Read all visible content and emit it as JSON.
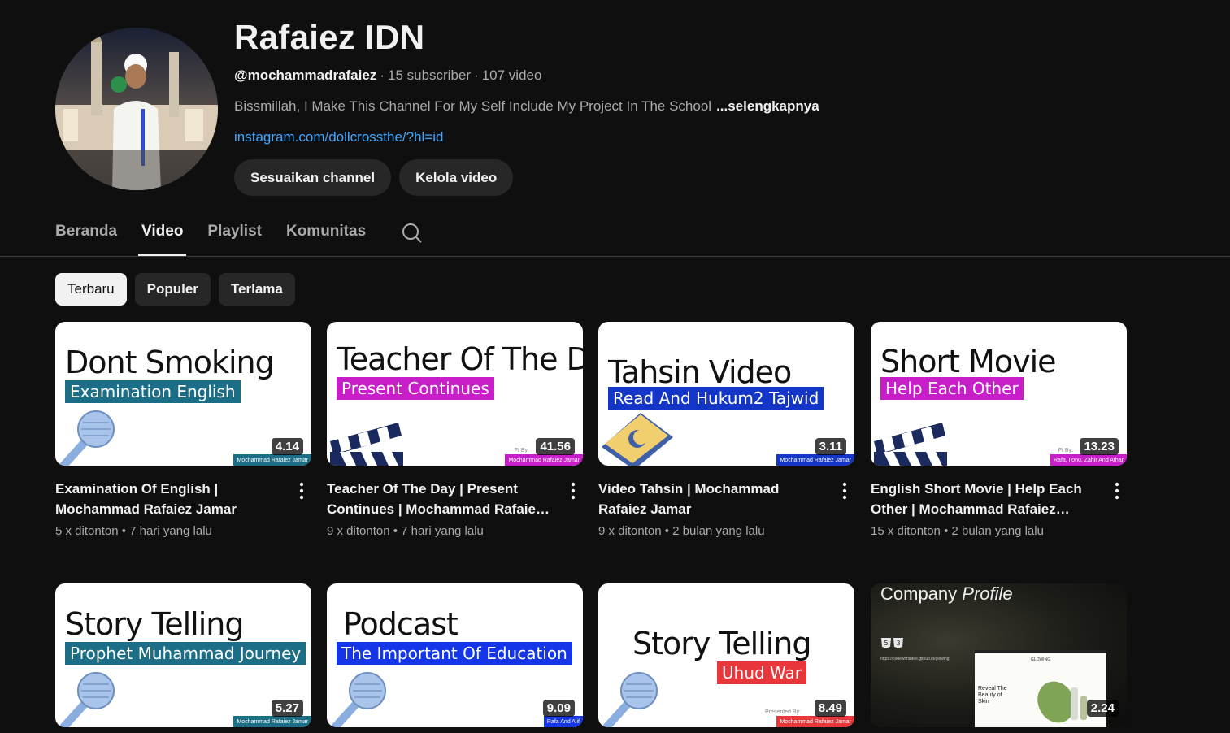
{
  "channel": {
    "name": "Rafaiez IDN",
    "handle": "@mochammadrafaiez",
    "subscribers": "15 subscriber",
    "video_count": "107 video",
    "description": "Bissmillah, I Make This Channel For My Self Include My Project In The School",
    "more_label": "...selengkapnya",
    "link": "instagram.com/dollcrossthe/?hl=id"
  },
  "actions": {
    "customize": "Sesuaikan channel",
    "manage": "Kelola video"
  },
  "tabs": [
    {
      "label": "Beranda",
      "active": false
    },
    {
      "label": "Video",
      "active": true
    },
    {
      "label": "Playlist",
      "active": false
    },
    {
      "label": "Komunitas",
      "active": false
    }
  ],
  "chips": [
    {
      "label": "Terbaru",
      "active": true
    },
    {
      "label": "Populer",
      "active": false
    },
    {
      "label": "Terlama",
      "active": false
    }
  ],
  "videos": [
    {
      "thumb_title": "Dont Smoking",
      "thumb_subtitle": "Examination English",
      "thumb_footer": "Mochammad Rafaiez Jamar",
      "thumb_credit": "",
      "sub_color": "#1c6e86",
      "duration": "4.14",
      "title": "Examination Of English | Mochammad Rafaiez Jamar",
      "views": "5 x ditonton",
      "age": "7 hari yang lalu",
      "icon": "microphone-icon"
    },
    {
      "thumb_title": "Teacher Of The Day",
      "thumb_subtitle": "Present Continues",
      "thumb_footer": "Mochammad Rafaiez Jamar",
      "thumb_credit": "Ft By:",
      "sub_color": "#c81ec9",
      "duration": "41.56",
      "title": "Teacher Of The Day | Present Continues | Mochammad Rafaiez Jamar",
      "views": "9 x ditonton",
      "age": "7 hari yang lalu",
      "icon": "clapperboard-icon"
    },
    {
      "thumb_title": "Tahsin Video",
      "thumb_subtitle": "Read And Hukum2 Tajwid",
      "thumb_footer": "Mochammad Rafaiez Jamar",
      "thumb_credit": "",
      "sub_color": "#1436c8",
      "duration": "3.11",
      "title": "Video Tahsin | Mochammad Rafaiez Jamar",
      "views": "9 x ditonton",
      "age": "2 bulan yang lalu",
      "icon": "quran-icon"
    },
    {
      "thumb_title": "Short Movie",
      "thumb_subtitle": "Help Each Other",
      "thumb_footer": "Rafa, Ilonu, Zahir And Athar",
      "thumb_credit": "Ft By:",
      "sub_color": "#c81ec9",
      "duration": "13.23",
      "title": "English Short Movie | Help Each Other | Mochammad Rafaiez Jamar",
      "views": "15 x ditonton",
      "age": "2 bulan yang lalu",
      "icon": "clapperboard-icon"
    },
    {
      "thumb_title": "Story Telling",
      "thumb_subtitle": "Prophet Muhammad Journey",
      "thumb_footer": "Mochammad Rafaiez Jamar",
      "thumb_credit": "",
      "sub_color": "#1c6e86",
      "duration": "5.27",
      "icon": "microphone-icon"
    },
    {
      "thumb_title": "Podcast",
      "thumb_subtitle": "The Important Of Education",
      "thumb_footer": "Rafa And Alif",
      "thumb_credit": "",
      "sub_color": "#1436e8",
      "duration": "9.09",
      "icon": "microphone-icon"
    },
    {
      "thumb_title": "Story Telling",
      "thumb_subtitle": "Uhud War",
      "thumb_footer": "Mochammad Rafaiez Jamar",
      "thumb_credit": "Presented By:",
      "sub_color": "#e8373a",
      "duration": "8.49",
      "icon": "microphone-icon"
    },
    {
      "thumb_title": "Company",
      "thumb_title_italic": "Profile",
      "thumb_url": "https://codewithadee.github.io/glowing",
      "shot_brand": "GLOWING",
      "shot_heading": "Reveal The Beauty of Skin",
      "duration": "2.24",
      "icon": "html-css-icon"
    }
  ],
  "colors": {
    "background": "#0f0f0f",
    "chip_bg": "#272727",
    "link": "#3ea6ff",
    "muted": "#aaaaaa"
  }
}
